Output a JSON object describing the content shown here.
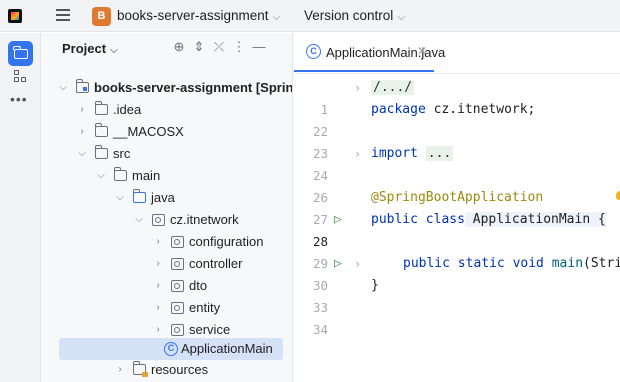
{
  "titlebar": {
    "project_badge": "B",
    "project_name": "books-server-assignment",
    "vcs_label": "Version control"
  },
  "panel": {
    "title": "Project"
  },
  "tree": [
    {
      "label": "books-server-assignment [Spring",
      "bold_part": "books-server-assignment [Spring",
      "kind": "module",
      "expanded": true
    },
    {
      "label": ".idea",
      "kind": "folder",
      "expanded": false
    },
    {
      "label": "__MACOSX",
      "kind": "folder",
      "expanded": false
    },
    {
      "label": "src",
      "kind": "folder",
      "expanded": true
    },
    {
      "label": "main",
      "kind": "folder",
      "expanded": true
    },
    {
      "label": "java",
      "kind": "source-folder",
      "expanded": true
    },
    {
      "label": "cz.itnetwork",
      "kind": "package",
      "expanded": true
    },
    {
      "label": "configuration",
      "kind": "package",
      "expanded": false
    },
    {
      "label": "controller",
      "kind": "package",
      "expanded": false
    },
    {
      "label": "dto",
      "kind": "package",
      "expanded": false
    },
    {
      "label": "entity",
      "kind": "package",
      "expanded": false
    },
    {
      "label": "service",
      "kind": "package",
      "expanded": false
    },
    {
      "label": "ApplicationMain",
      "kind": "class",
      "selected": true
    },
    {
      "label": "resources",
      "kind": "resources-folder",
      "expanded": false
    }
  ],
  "editor": {
    "tab_label": "ApplicationMain.java",
    "class_icon_letter": "C",
    "lines": [
      {
        "num": "1",
        "code": "/.../",
        "folded": true
      },
      {
        "num": "22",
        "code_kw": "package",
        "code_rest": " cz.itnetwork;"
      },
      {
        "num": "23",
        "code": ""
      },
      {
        "num": "24",
        "code_kw": "import",
        "code_rest": "...",
        "folded": true
      },
      {
        "num": "26",
        "code": ""
      },
      {
        "num": "27",
        "annotation": "@SpringBootApplication"
      },
      {
        "num": "28",
        "code_kw": "public class",
        "code_rest": " ApplicationMain {"
      },
      {
        "num": "29",
        "code": ""
      },
      {
        "num": "30",
        "code_kw": "public static void",
        "method": "main",
        "code_rest": "(Stri"
      },
      {
        "num": "33",
        "code": "}"
      },
      {
        "num": "34",
        "code": ""
      }
    ]
  }
}
